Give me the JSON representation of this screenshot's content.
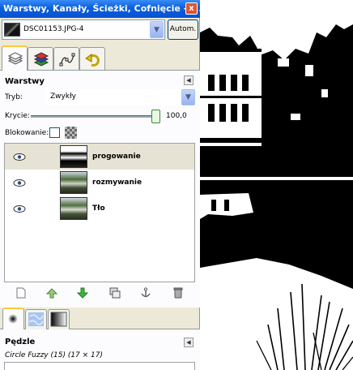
{
  "window": {
    "title": "Warstwy, Kanały, Ścieżki, Cofnięcie - P...",
    "close_label": "x"
  },
  "image_selector": {
    "value": "DSC01153.JPG-4",
    "autom_label": "Autom."
  },
  "dock_tabs": [
    "layers-icon",
    "channels-icon",
    "paths-icon",
    "undo-icon"
  ],
  "layers_panel": {
    "title": "Warstwy",
    "mode_label": "Tryb:",
    "mode_value": "Zwykły",
    "opacity_label": "Krycie:",
    "opacity_value": "100,0",
    "opacity_fraction": 1.0,
    "lock_label": "Blokowanie:",
    "layers": [
      {
        "name": "progowanie",
        "selected": true
      },
      {
        "name": "rozmywanie",
        "selected": false
      },
      {
        "name": "Tło",
        "selected": false
      }
    ],
    "toolbar_icons": [
      "new-layer-icon",
      "raise-layer-icon",
      "lower-layer-icon",
      "duplicate-layer-icon",
      "anchor-layer-icon",
      "delete-layer-icon"
    ]
  },
  "brush_tabs": [
    "brushes-icon",
    "patterns-icon",
    "gradients-icon"
  ],
  "brushes_panel": {
    "title": "Pędzle",
    "brush_name": "Circle Fuzzy (15) (17 × 17)"
  },
  "colors": {
    "titlebar": "#0a5fe0",
    "selected_row": "#e7e3d4",
    "dock_bg": "#ece9d8",
    "accent_tab": "#ffc83c"
  }
}
